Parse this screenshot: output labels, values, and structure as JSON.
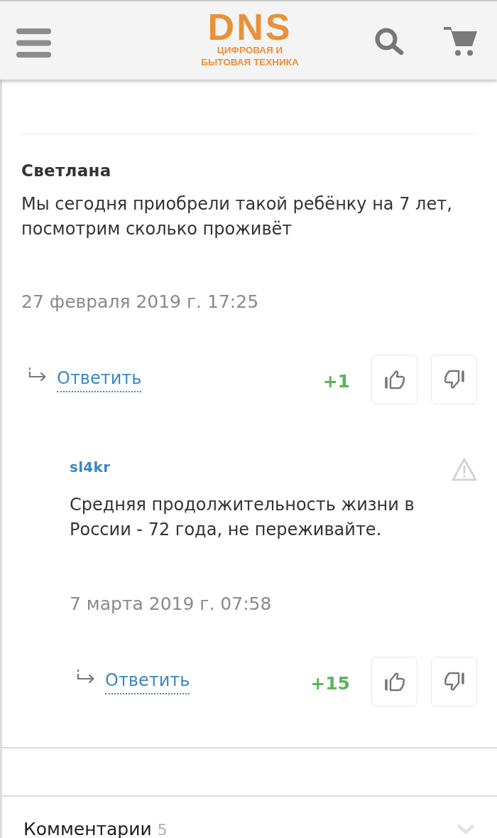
{
  "header": {
    "logo": {
      "brand": "DNS",
      "tagline_line_1": "ЦИФРОВАЯ И",
      "tagline_line_2": "БЫТОВАЯ ТЕХНИКА"
    }
  },
  "comments": [
    {
      "author": "Светлана",
      "text": "Мы сегодня приобрели такой ребёнку на 7 лет, посмотрим сколько проживёт",
      "date": "27 февраля 2019 г. 17:25",
      "reply_link": "Ответить",
      "score": "+1",
      "reportable": false,
      "replies": [
        {
          "author": "sl4kr",
          "text": "Средняя продолжительность жизни в России - 72 года, не переживайте.",
          "date": "7 марта 2019 г. 07:58",
          "reply_link": "Ответить",
          "score": "+15",
          "reportable": true
        }
      ]
    }
  ],
  "comments_section": {
    "label": "Комментарии",
    "count": "5",
    "expanded": false
  }
}
